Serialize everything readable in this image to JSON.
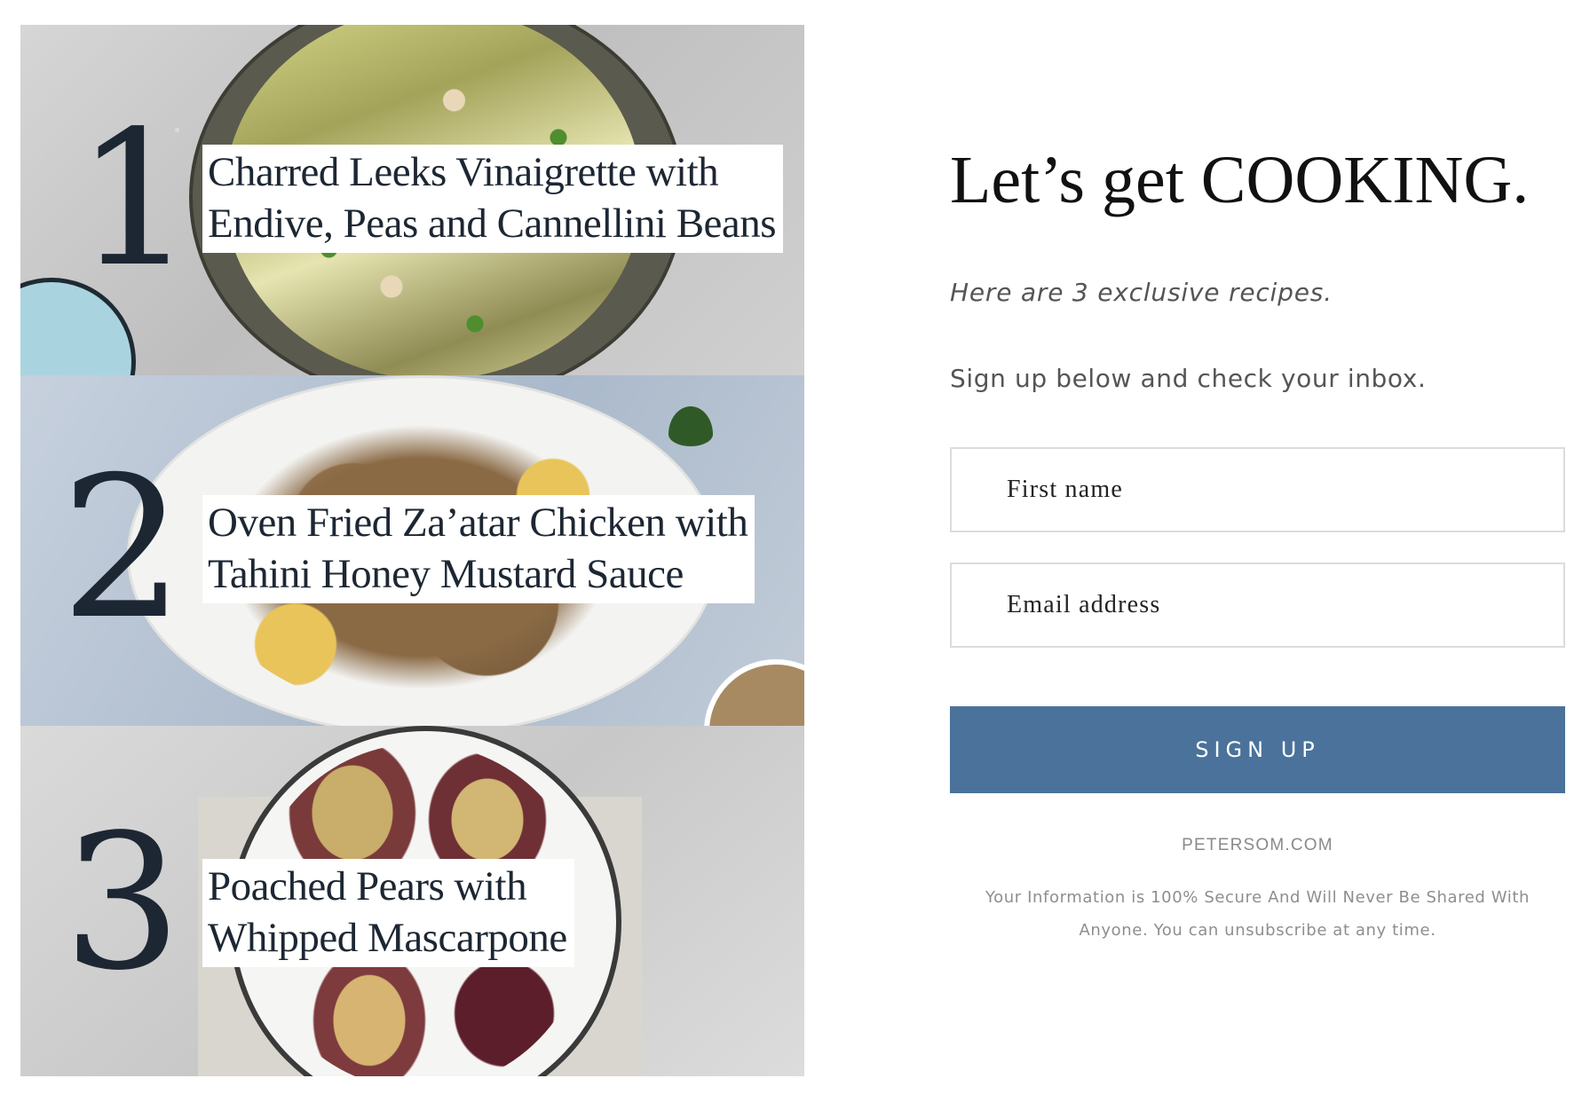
{
  "recipes": [
    {
      "number": "1",
      "title_line1": "Charred Leeks Vinaigrette with",
      "title_line2": "Endive, Peas and Cannellini Beans"
    },
    {
      "number": "2",
      "title_line1": "Oven Fried Za’atar Chicken with",
      "title_line2": "Tahini Honey Mustard Sauce"
    },
    {
      "number": "3",
      "title_line1": "Poached Pears with",
      "title_line2": "Whipped Mascarpone"
    }
  ],
  "signup": {
    "headline": "Let’s get COOKING.",
    "subhead": "Here are 3 exclusive recipes.",
    "intro": "Sign up below and check your inbox.",
    "first_name_placeholder": "First name",
    "email_placeholder": "Email address",
    "button_label": "SIGN UP",
    "site_label": "PETERSOM.COM",
    "disclaimer_line1": "Your Information is 100% Secure And Will Never Be Shared With",
    "disclaimer_line2": "Anyone. You can unsubscribe at any time."
  },
  "colors": {
    "button": "#4a729a",
    "text_dark": "#1d2733"
  }
}
